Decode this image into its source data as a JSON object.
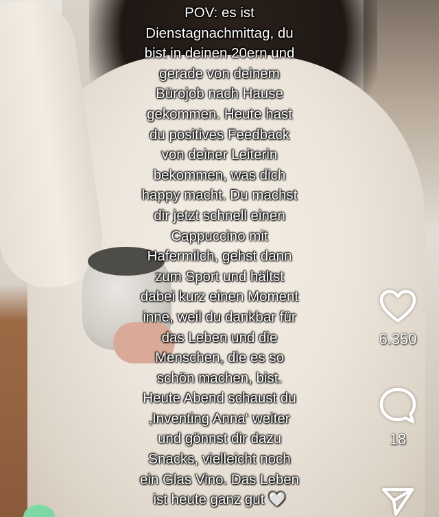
{
  "caption": {
    "text": "POV: es ist\nDienstagnachmittag, du\nbist in deinen 20ern und\ngerade von deinem\nBürojob nach Hause\ngekommen. Heute hast\ndu positives Feedback\nvon deiner Leiterin\nbekommen, was dich\nhappy macht. Du machst\ndir jetzt schnell einen\nCappuccino mit\nHafermilch, gehst dann\nzum Sport und hältst\ndabei kurz einen Moment\ninne, weil du dankbar für\ndas Leben und die\nMenschen, die es so\nschön machen, bist.\nHeute Abend schaust du\n‚Inventing Anna‘ weiter\nund gönnst dir dazu\nSnacks, vielleicht noch\nein Glas Vino. Das Leben\nist heute ganz gut 🤍"
  },
  "actions": {
    "like": {
      "icon": "heart-icon",
      "count": "6.350"
    },
    "comment": {
      "icon": "comment-bubble-icon",
      "count": "18"
    },
    "share": {
      "icon": "share-arrow-icon"
    }
  },
  "colors": {
    "overlay_text": "#ffffff",
    "sweater": "#efe9e0",
    "hair": "#211a16"
  }
}
